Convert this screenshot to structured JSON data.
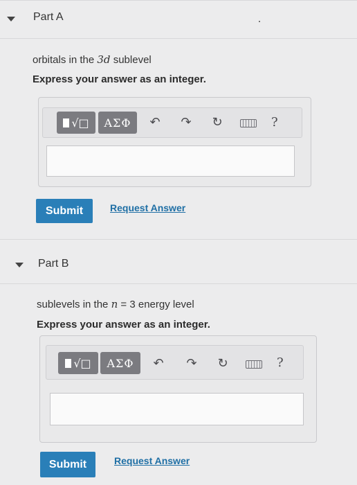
{
  "part_a": {
    "title": "Part A",
    "question_text": "orbitals in the ",
    "question_var": "3d",
    "question_suffix": " sublevel",
    "instruction": "Express your answer as an integer.",
    "toolbar": {
      "template_icon": "radical-template-icon",
      "greek_label": "ΑΣΦ",
      "undo_icon": "undo-icon",
      "redo_icon": "redo-icon",
      "reset_icon": "reset-icon",
      "keyboard_icon": "keyboard-icon",
      "help_label": "?"
    },
    "answer_value": "",
    "submit_label": "Submit",
    "request_label": "Request Answer"
  },
  "part_b": {
    "title": "Part B",
    "question_text": "sublevels in the ",
    "question_var": "n",
    "question_suffix": " = 3 energy level",
    "instruction": "Express your answer as an integer.",
    "toolbar": {
      "template_icon": "radical-template-icon",
      "greek_label": "ΑΣΦ",
      "undo_icon": "undo-icon",
      "redo_icon": "redo-icon",
      "reset_icon": "reset-icon",
      "keyboard_icon": "keyboard-icon",
      "help_label": "?"
    },
    "answer_value": "",
    "submit_label": "Submit",
    "request_label": "Request Answer"
  },
  "colors": {
    "submit": "#2a7fb8",
    "link": "#1f6fa5",
    "toolbar_button": "#7b7b80"
  }
}
